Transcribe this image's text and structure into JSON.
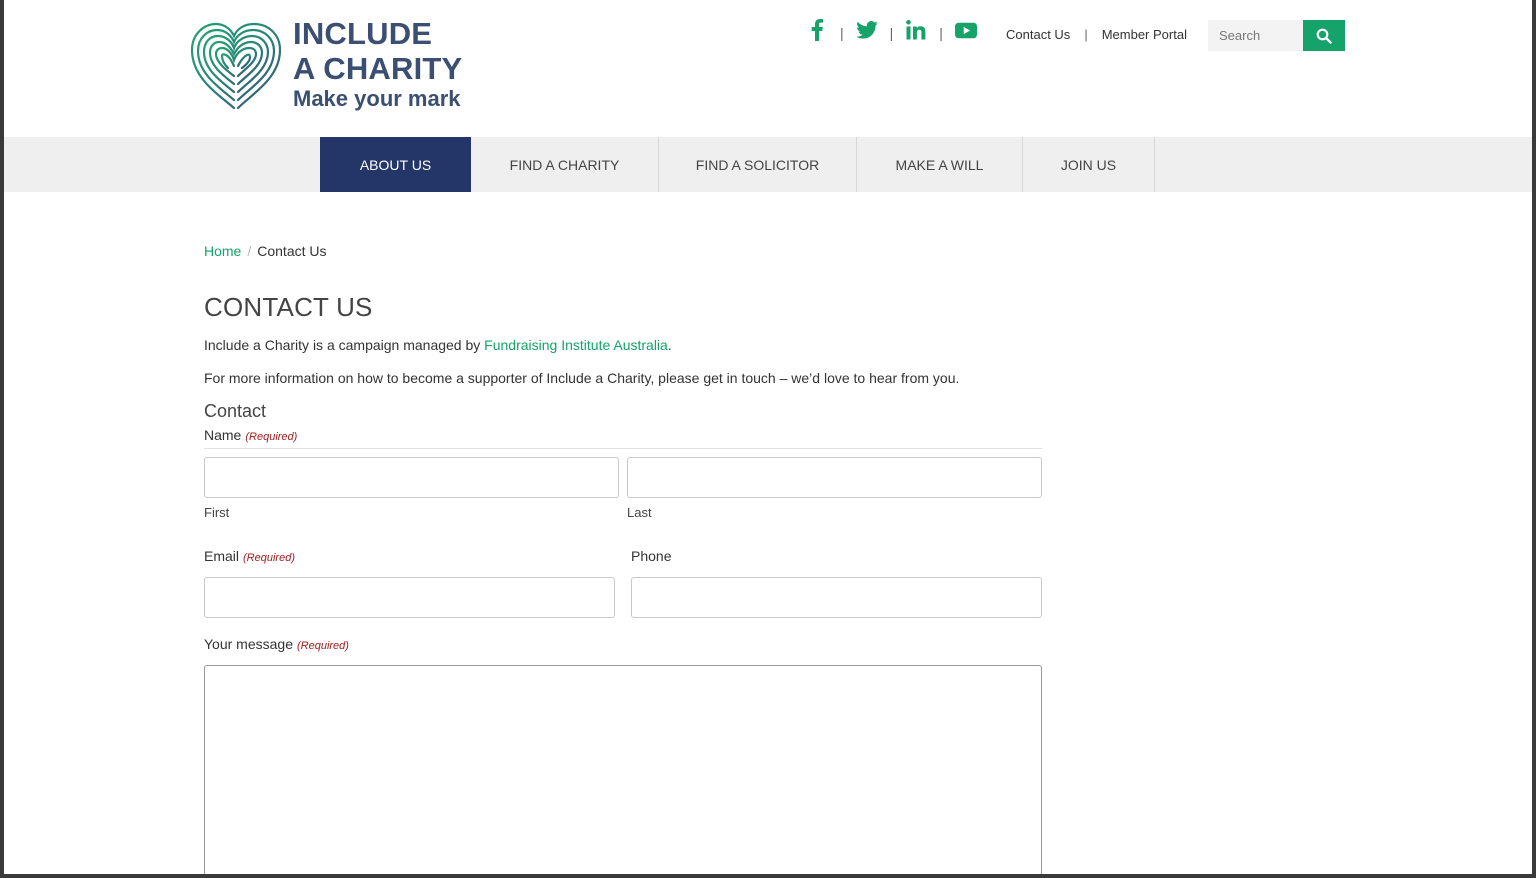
{
  "header": {
    "logo": {
      "line1": "INCLUDE",
      "line2": "A CHARITY",
      "line3": "Make your mark"
    },
    "social": [
      "facebook-icon",
      "twitter-icon",
      "linkedin-icon",
      "youtube-icon"
    ],
    "links": {
      "contact": "Contact Us",
      "portal": "Member Portal"
    },
    "search": {
      "placeholder": "Search"
    }
  },
  "nav": {
    "items": [
      "ABOUT US",
      "FIND A CHARITY",
      "FIND A SOLICITOR",
      "MAKE A WILL",
      "JOIN US"
    ],
    "active": "ABOUT US"
  },
  "breadcrumb": {
    "home": "Home",
    "separator": "/",
    "current": "Contact Us"
  },
  "page": {
    "title": "CONTACT US",
    "intro_prefix": "Include a Charity is a campaign managed by ",
    "intro_link": "Fundraising Institute Australia",
    "intro_suffix": ".",
    "info": "For more information on how to become a supporter of Include a Charity, please get in touch – we’d love to hear from you."
  },
  "form": {
    "title": "Contact",
    "required": "(Required)",
    "name_label": "Name",
    "first_label": "First",
    "last_label": "Last",
    "email_label": "Email",
    "phone_label": "Phone",
    "message_label": "Your message",
    "values": {
      "first": "",
      "last": "",
      "email": "",
      "phone": "",
      "message": ""
    }
  },
  "colors": {
    "brand_green": "#16a36a",
    "nav_active": "#243668",
    "logo_navy": "#3b4f72",
    "required_red": "#a02020"
  }
}
